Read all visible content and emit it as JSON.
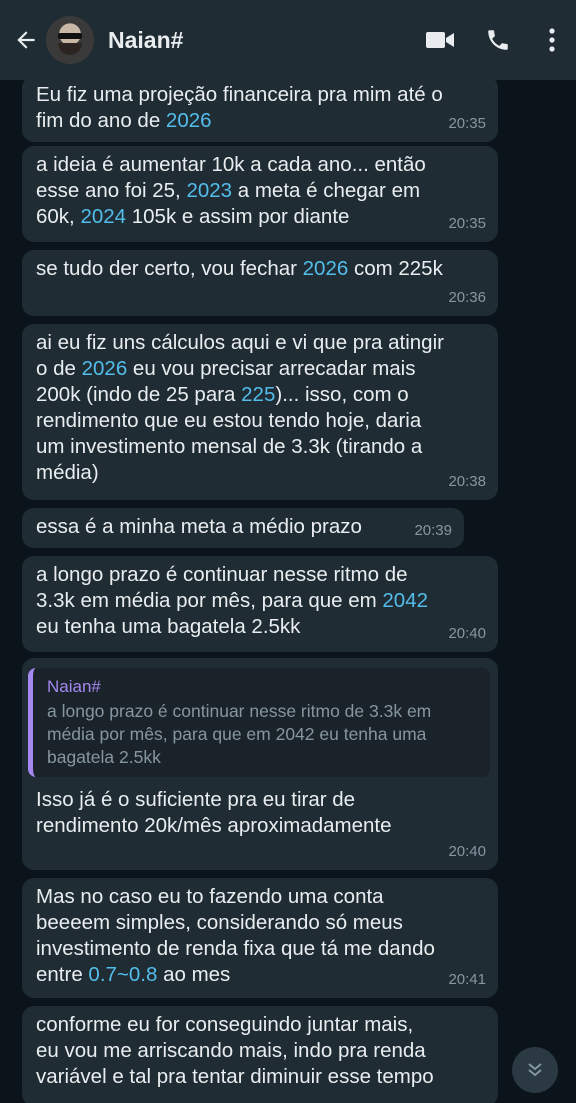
{
  "header": {
    "contact_name": "Naian#"
  },
  "messages": [
    {
      "parts": [
        {
          "t": "Eu fiz uma projeção financeira pra mim até o\nfim do ano de "
        },
        {
          "t": "2026",
          "link": true
        }
      ],
      "time": "20:35"
    },
    {
      "parts": [
        {
          "t": "a ideia é aumentar 10k a cada ano... então\nesse ano foi 25, "
        },
        {
          "t": "2023",
          "link": true
        },
        {
          "t": " a meta é chegar em\n60k, "
        },
        {
          "t": "2024",
          "link": true
        },
        {
          "t": " 105k e assim por diante"
        }
      ],
      "time": "20:35"
    },
    {
      "parts": [
        {
          "t": "se tudo der certo, vou fechar "
        },
        {
          "t": "2026",
          "link": true
        },
        {
          "t": " com 225k"
        }
      ],
      "time": "20:36"
    },
    {
      "parts": [
        {
          "t": "ai eu fiz uns cálculos aqui e vi que pra atingir\no de "
        },
        {
          "t": "2026",
          "link": true
        },
        {
          "t": " eu vou precisar arrecadar mais\n200k (indo de 25 para "
        },
        {
          "t": "225",
          "link": true
        },
        {
          "t": ")... isso, com o\nrendimento que eu estou tendo hoje, daria\num investimento mensal de 3.3k (tirando a\nmédia)"
        }
      ],
      "time": "20:38"
    },
    {
      "parts": [
        {
          "t": "essa é a minha meta a médio prazo"
        }
      ],
      "time": "20:39"
    },
    {
      "parts": [
        {
          "t": "a longo prazo é continuar nesse ritmo de\n3.3k em média por mês, para que em "
        },
        {
          "t": "2042",
          "link": true
        },
        {
          "t": "\neu tenha uma bagatela 2.5kk"
        }
      ],
      "time": "20:40"
    },
    {
      "quote": {
        "author": "Naian#",
        "text": "a longo prazo é continuar nesse ritmo de 3.3k em média por mês, para que em 2042 eu tenha uma bagatela 2.5kk"
      },
      "parts": [
        {
          "t": "Isso já é o suficiente pra eu tirar de\nrendimento 20k/mês aproximadamente"
        }
      ],
      "time": "20:40"
    },
    {
      "parts": [
        {
          "t": "Mas no caso eu to fazendo uma conta\nbeeeem simples, considerando só meus\ninvestimento de renda fixa que tá me dando\nentre "
        },
        {
          "t": "0.7~0.8",
          "link": true
        },
        {
          "t": " ao mes"
        }
      ],
      "time": "20:41"
    },
    {
      "parts": [
        {
          "t": "conforme eu for conseguindo juntar mais,\neu vou me arriscando mais, indo pra renda\nvariável e tal pra tentar diminuir esse tempo"
        }
      ],
      "time": ""
    }
  ]
}
